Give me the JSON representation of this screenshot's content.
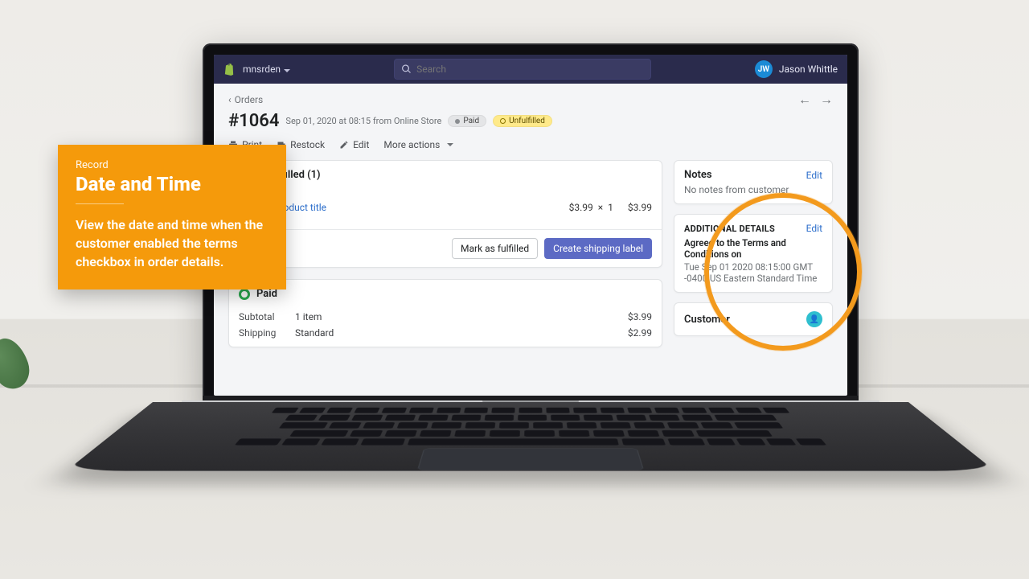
{
  "topbar": {
    "store_name": "mnsrden",
    "search_placeholder": "Search",
    "user_initials": "JW",
    "user_name": "Jason Whittle"
  },
  "breadcrumb": {
    "back_label": "Orders"
  },
  "order": {
    "id": "#1064",
    "timestamp": "Sep 01, 2020 at 08:15 from Online Store",
    "paid_badge": "Paid",
    "unfulfilled_badge": "Unfulfilled"
  },
  "actions": {
    "print": "Print",
    "restock": "Restock",
    "edit": "Edit",
    "more": "More actions"
  },
  "fulfillment": {
    "header": "Unfulfilled (1)",
    "item_count_badge": "1",
    "product_title": "Product title",
    "unit_price": "$3.99",
    "qty_sep": "×",
    "qty": "1",
    "line_total": "$3.99",
    "mark_fulfilled": "Mark as fulfilled",
    "create_label": "Create shipping label"
  },
  "payment": {
    "header": "Paid",
    "rows": {
      "subtotal_label": "Subtotal",
      "subtotal_desc": "1 item",
      "subtotal_amount": "$3.99",
      "shipping_label": "Shipping",
      "shipping_desc": "Standard",
      "shipping_amount": "$2.99"
    }
  },
  "side": {
    "notes_title": "Notes",
    "notes_edit": "Edit",
    "notes_empty": "No notes from customer",
    "additional_title": "ADDITIONAL DETAILS",
    "additional_edit": "Edit",
    "additional_key": "Agreed to the Terms and Conditions on",
    "additional_value": "Tue Sep 01 2020 08:15:00 GMT -0400 US Eastern Standard Time",
    "customer_title": "Customer"
  },
  "promo": {
    "tag": "Record",
    "title": "Date and Time",
    "body": "View the date and time when the customer enabled the terms checkbox in order details."
  }
}
